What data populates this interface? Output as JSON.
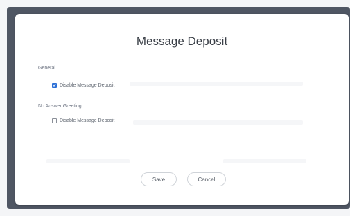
{
  "dialog": {
    "title": "Message Deposit",
    "sections": [
      {
        "label": "General",
        "checkbox_label": "Disable Message Deposit",
        "checked": true
      },
      {
        "label": "No Answer Greeting",
        "checkbox_label": "Disable Message Deposit",
        "checked": false
      }
    ],
    "save_label": "Save",
    "cancel_label": "Cancel"
  },
  "colors": {
    "backdrop": "#4f5663",
    "checkbox_accent": "#2b6fd6"
  }
}
